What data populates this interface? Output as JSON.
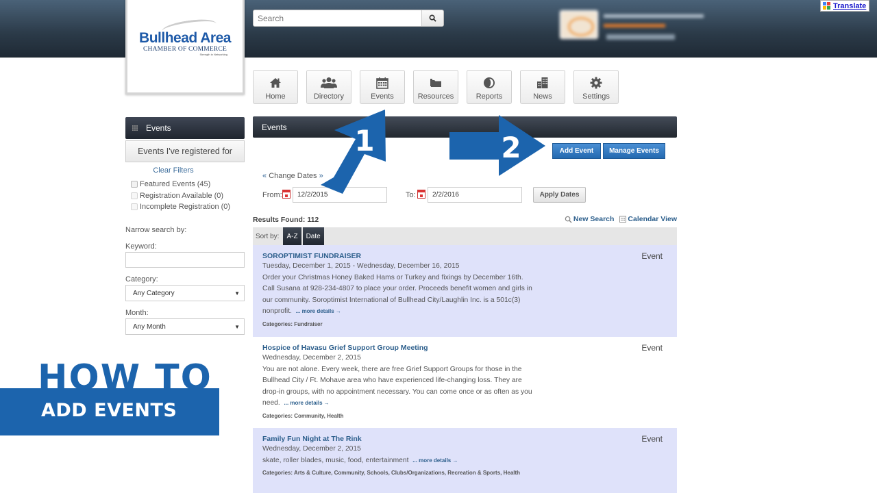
{
  "brand": {
    "name": "Bullhead Area",
    "subtitle": "CHAMBER OF COMMERCE",
    "tagline": "Strength in Networking",
    "accent_color": "#1c64ad"
  },
  "header": {
    "search_placeholder": "Search",
    "translate_label": "Translate"
  },
  "nav": [
    {
      "label": "Home",
      "icon": "home-icon"
    },
    {
      "label": "Directory",
      "icon": "users-icon"
    },
    {
      "label": "Events",
      "icon": "calendar-icon"
    },
    {
      "label": "Resources",
      "icon": "folder-icon"
    },
    {
      "label": "Reports",
      "icon": "pie-chart-icon"
    },
    {
      "label": "News",
      "icon": "building-icon"
    },
    {
      "label": "Settings",
      "icon": "gear-icon"
    }
  ],
  "sidebar": {
    "title": "Events",
    "registered_button": "Events I've registered for",
    "clear_filters": "Clear Filters",
    "filters": [
      {
        "label": "Featured Events (45)",
        "checked": false
      },
      {
        "label": "Registration Available (0)",
        "checked": false
      },
      {
        "label": "Incomplete Registration (0)",
        "checked": false
      }
    ],
    "narrow_label": "Narrow search by:",
    "keyword_label": "Keyword:",
    "keyword_value": "",
    "category_label": "Category:",
    "category_value": "Any Category",
    "month_label": "Month:",
    "month_value": "Any Month"
  },
  "main": {
    "title": "Events",
    "add_event": "Add Event",
    "manage_events": "Manage Events",
    "change_dates_prefix": "«",
    "change_dates": "Change Dates",
    "change_dates_suffix": "»",
    "from_label": "From:",
    "from_value": "12/2/2015",
    "to_label": "To:",
    "to_value": "2/2/2016",
    "apply_dates": "Apply Dates",
    "results_found": "Results Found: 112",
    "new_search": "New Search",
    "calendar_view": "Calendar View",
    "sort_label": "Sort by:",
    "sort_options": [
      "A-Z",
      "Date"
    ]
  },
  "events": [
    {
      "title": "SOROPTIMIST FUNDRAISER",
      "date": "Tuesday, December 1, 2015 - Wednesday, December 16, 2015",
      "description": "Order your Christmas Honey Baked Hams or Turkey and fixings by December 16th. Call Susana at 928-234-4807 to place your order. Proceeds benefit women and girls in our community. Soroptimist International of Bullhead City/Laughlin Inc. is a 501c(3) nonprofit.",
      "more": "... more details →",
      "categories": "Categories: Fundraiser",
      "type": "Event"
    },
    {
      "title": "Hospice of Havasu Grief Support Group Meeting",
      "date": "Wednesday, December 2, 2015",
      "description": "You are not alone. Every week, there are free Grief Support Groups for those in the Bullhead City / Ft. Mohave area who have experienced life-changing loss. They are drop-in groups, with no appointment necessary. You can come once or as often as you need.",
      "more": "... more details →",
      "categories": "Categories: Community, Health",
      "type": "Event"
    },
    {
      "title": "Family Fun Night at The Rink",
      "date": "Wednesday, December 2, 2015",
      "description": "skate, roller blades, music, food, entertainment",
      "more": "... more details →",
      "categories": "Categories: Arts & Culture, Community, Schools, Clubs/Organizations, Recreation & Sports, Health",
      "type": "Event"
    }
  ],
  "overlay": {
    "howto_line1": "HOW TO",
    "howto_line2": "ADD EVENTS",
    "step1": "1",
    "step2": "2"
  }
}
